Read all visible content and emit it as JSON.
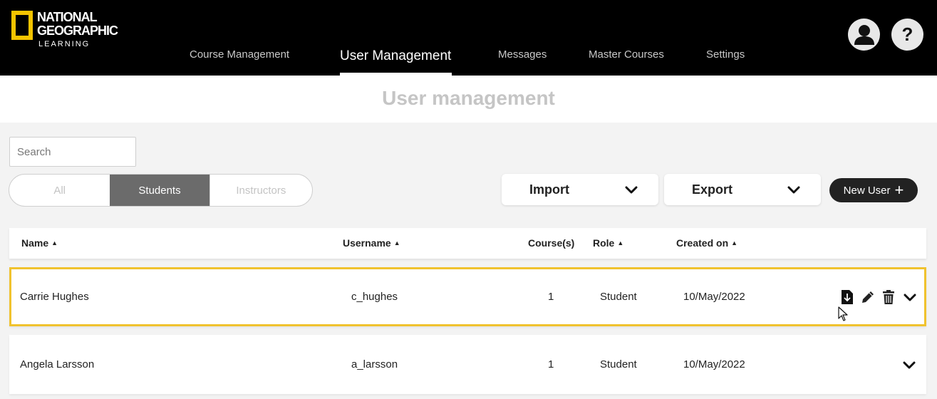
{
  "brand": {
    "line1": "NATIONAL",
    "line2": "GEOGRAPHIC",
    "line3": "LEARNING",
    "accent": "#f5c400"
  },
  "nav": {
    "items": [
      {
        "label": "Course Management"
      },
      {
        "label": "User Management"
      },
      {
        "label": "Messages"
      },
      {
        "label": "Master Courses"
      },
      {
        "label": "Settings"
      }
    ],
    "active": "User Management",
    "profile_icon": "user-icon",
    "help_icon": "help-icon",
    "help_glyph": "?"
  },
  "page": {
    "title": "User management"
  },
  "search": {
    "placeholder": "Search",
    "value": ""
  },
  "filter": {
    "options": [
      "All",
      "Students",
      "Instructors"
    ],
    "selected": "Students"
  },
  "actions": {
    "import_label": "Import",
    "export_label": "Export",
    "new_user_label": "New User",
    "new_user_icon": "+"
  },
  "table": {
    "columns": [
      {
        "label": "Name",
        "sort": "▲"
      },
      {
        "label": "Username",
        "sort": "▲"
      },
      {
        "label": "Course(s)",
        "sort": ""
      },
      {
        "label": "Role",
        "sort": "▲"
      },
      {
        "label": "Created on",
        "sort": "▲"
      }
    ],
    "rows": [
      {
        "name": "Carrie Hughes",
        "username": "c_hughes",
        "courses": "1",
        "role": "Student",
        "created_on": "10/May/2022",
        "selected": true
      },
      {
        "name": "Angela Larsson",
        "username": "a_larsson",
        "courses": "1",
        "role": "Student",
        "created_on": "10/May/2022",
        "selected": false
      }
    ],
    "row_icons": [
      "download-icon",
      "edit-icon",
      "trash-icon",
      "chevron-down-icon"
    ]
  },
  "colors": {
    "topbar": "#000000",
    "selected_row_border": "#f0c22e",
    "active_filter": "#6b6b6b",
    "title_gray": "#c5c5c5"
  }
}
